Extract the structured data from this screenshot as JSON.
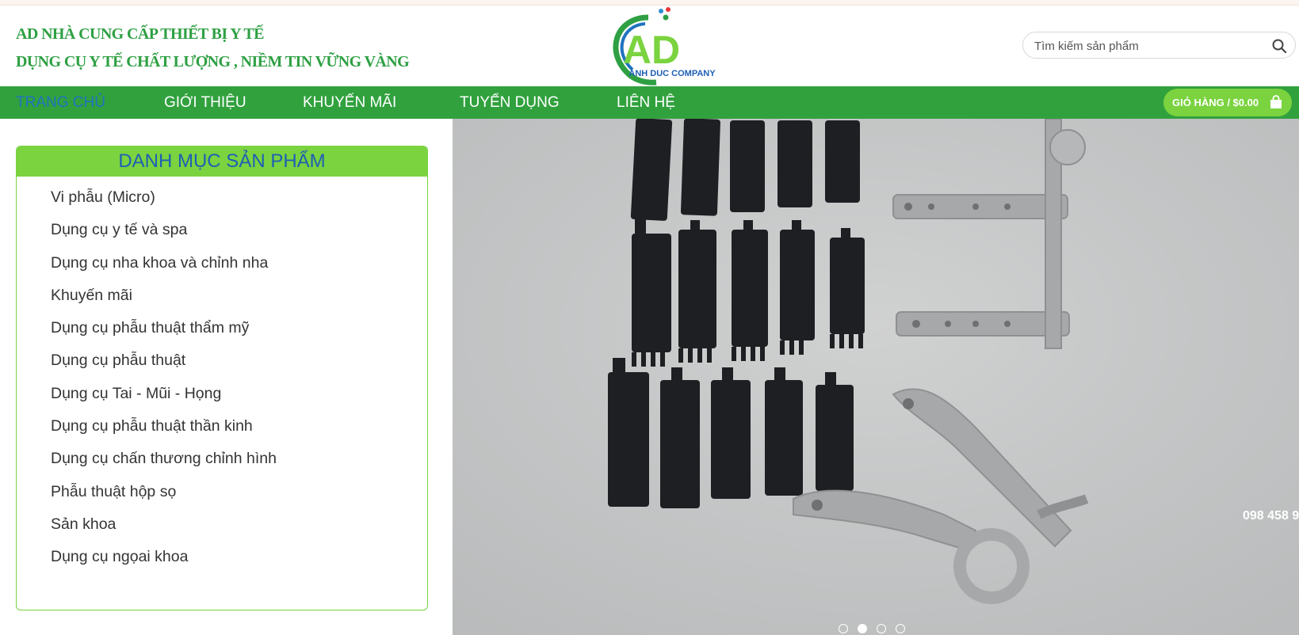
{
  "header": {
    "tagline_line1": "AD NHÀ CUNG CẤP THIẾT BỊ Y TẾ",
    "tagline_line2": "DỤNG CỤ Y TẾ CHẤT LƯỢNG , NIỀM TIN VỮNG VÀNG",
    "logo_letters": "AD",
    "logo_company": "ANH DUC COMPANY",
    "search_placeholder": "Tìm kiếm sản phẩm",
    "search_icon": "search-icon"
  },
  "nav": {
    "items": [
      {
        "label": "Trang chủ",
        "active": true
      },
      {
        "label": "Giới thiệu",
        "active": false
      },
      {
        "label": "Khuyến mãi",
        "active": false
      },
      {
        "label": "Tuyển dụng",
        "active": false
      },
      {
        "label": "Liên hệ",
        "active": false
      }
    ],
    "cart_label": "GIỎ HÀNG / $0.00",
    "cart_icon": "shopping-bag-icon"
  },
  "sidebar": {
    "title": "DANH MỤC SẢN PHẨM",
    "items": [
      "Vi phẫu (Micro)",
      "Dụng cụ y tế và spa",
      "Dụng cụ nha khoa và chỉnh nha",
      "Khuyến mãi",
      "Dụng cụ phẫu thuật thẩm mỹ",
      "Dụng cụ phẫu thuật",
      "Dụng cụ Tai - Mũi - Họng",
      "Dụng cụ phẫu thuật thần kinh",
      "Dụng cụ chấn thương chỉnh hình",
      "Phẫu thuật hộp sọ",
      "Sản khoa",
      "Dụng cụ ngọai khoa"
    ]
  },
  "slider": {
    "phone_text": "098 458 9",
    "dot_count": 4,
    "active_dot": 1
  },
  "colors": {
    "brand_green": "#31a13e",
    "light_green": "#7ad33f",
    "active_blue": "#1e73be"
  }
}
